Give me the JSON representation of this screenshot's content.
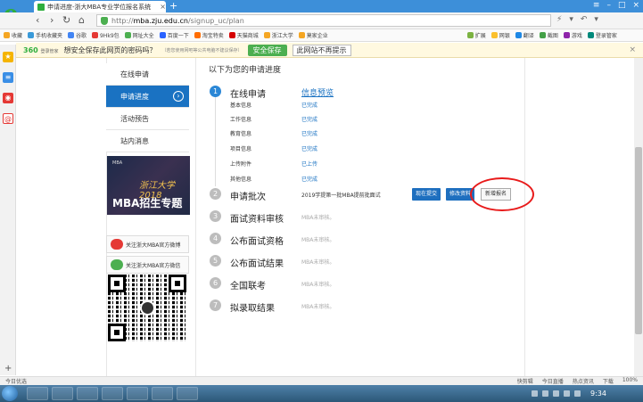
{
  "browser": {
    "tab_title": "申请进度-浙大MBA专业学位报名系统",
    "url_prefix": "http://",
    "url_domain": "mba.zju.edu.cn",
    "url_path": "/signup_uc/plan",
    "new_tab": "+",
    "bookmarks": [
      "收藏",
      "手机收藏夹",
      "谷歌",
      "9Hk9包",
      "网址大全",
      "百度一下",
      "淘宝特卖",
      "天猫商城",
      "浙江大学",
      "莫家企业",
      "扩展",
      "网银",
      "翻译",
      "截图",
      "游戏",
      "登录管家"
    ]
  },
  "security_bar": {
    "brand": "360",
    "brand_sub": "登录管家",
    "question": "想安全保存此网页的密码吗？",
    "tip": "（若您使用网吧等公共电脑不建议保存）",
    "save_label": "安全保存",
    "never_label": "此网站不再提示",
    "close": "×"
  },
  "sidebar": {
    "items": [
      {
        "label": "在线申请",
        "active": false
      },
      {
        "label": "申请进度",
        "active": true,
        "arrow": "›"
      },
      {
        "label": "活动预告",
        "active": false
      },
      {
        "label": "站内消息",
        "active": false
      }
    ],
    "banner_mba": "MBA",
    "banner_script": "浙江大学2018",
    "banner_title": "MBA招生专题",
    "weibo_label": "关注浙大MBA官方微博",
    "wechat_label": "关注浙大MBA官方微信"
  },
  "main": {
    "heading": "以下为您的申请进度",
    "steps": [
      {
        "num": "1",
        "title": "在线申请",
        "link": "信息预览",
        "active": true
      },
      {
        "num": "2",
        "title": "申请批次",
        "text": "2019学提第一批MBA提前批面试"
      },
      {
        "num": "3",
        "title": "面试资料审核",
        "status": "MBA未审核。"
      },
      {
        "num": "4",
        "title": "公布面试资格",
        "status": "MBA未审核。"
      },
      {
        "num": "5",
        "title": "公布面试结果",
        "status": "MBA未审核。"
      },
      {
        "num": "6",
        "title": "全国联考",
        "status": "MBA未审核。"
      },
      {
        "num": "7",
        "title": "拟录取结果",
        "status": "MBA未审核。"
      }
    ],
    "substeps": [
      {
        "label": "基本信息",
        "value": "已完成"
      },
      {
        "label": "工作信息",
        "value": "已完成"
      },
      {
        "label": "教育信息",
        "value": "已完成"
      },
      {
        "label": "项目信息",
        "value": "已完成"
      },
      {
        "label": "上传附件",
        "value": "已上传"
      },
      {
        "label": "其他信息",
        "value": "已完成"
      }
    ],
    "btn_submit": "现在提交",
    "btn_modify": "修改资料",
    "btn_new": "新增报名"
  },
  "statusbar": {
    "left": "今日优选",
    "right": [
      "快剪辑",
      "今日直播",
      "热点资讯",
      "下载",
      "100%"
    ]
  },
  "taskbar": {
    "time": "9:34"
  }
}
